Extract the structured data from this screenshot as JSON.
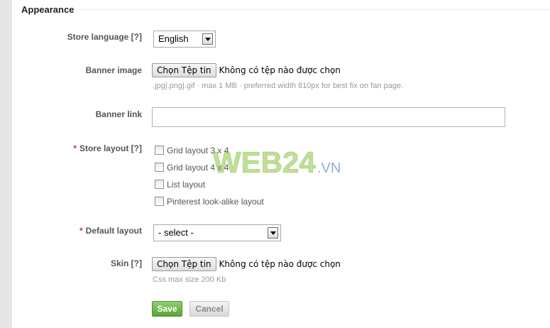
{
  "section": {
    "title": "Appearance"
  },
  "store_language": {
    "label": "Store language",
    "help": "[?]",
    "selected": "English"
  },
  "banner_image": {
    "label": "Banner image",
    "button": "Chọn Tệp tin",
    "status": "Không có tệp nào được chọn",
    "hint": ".jpg|.png|.gif · max 1 MB · preferred width 810px for best fix on fan page."
  },
  "banner_link": {
    "label": "Banner link",
    "value": ""
  },
  "store_layout": {
    "required_mark": "*",
    "label": "Store layout",
    "help": "[?]",
    "options": [
      {
        "label": "Grid layout 3 x 4",
        "checked": false
      },
      {
        "label": "Grid layout 4 x 4",
        "checked": false
      },
      {
        "label": "List layout",
        "checked": false
      },
      {
        "label": "Pinterest look-alike layout",
        "checked": false
      }
    ]
  },
  "default_layout": {
    "required_mark": "*",
    "label": "Default layout",
    "selected": "- select -"
  },
  "skin": {
    "label": "Skin",
    "help": "[?]",
    "button": "Chọn Tệp tin",
    "status": "Không có tệp nào được chọn",
    "hint": "Css max size 200 Kb"
  },
  "actions": {
    "save": "Save",
    "cancel": "Cancel"
  },
  "watermark": {
    "text": "WEB24",
    "suffix": ".VN"
  },
  "colors": {
    "save_button": "#6ab545",
    "required_mark": "#c0392b",
    "watermark_green": "#8dc63f"
  },
  "icons": {
    "select_arrow": "chevron-down-icon",
    "checkbox": "checkbox-unchecked-icon"
  }
}
